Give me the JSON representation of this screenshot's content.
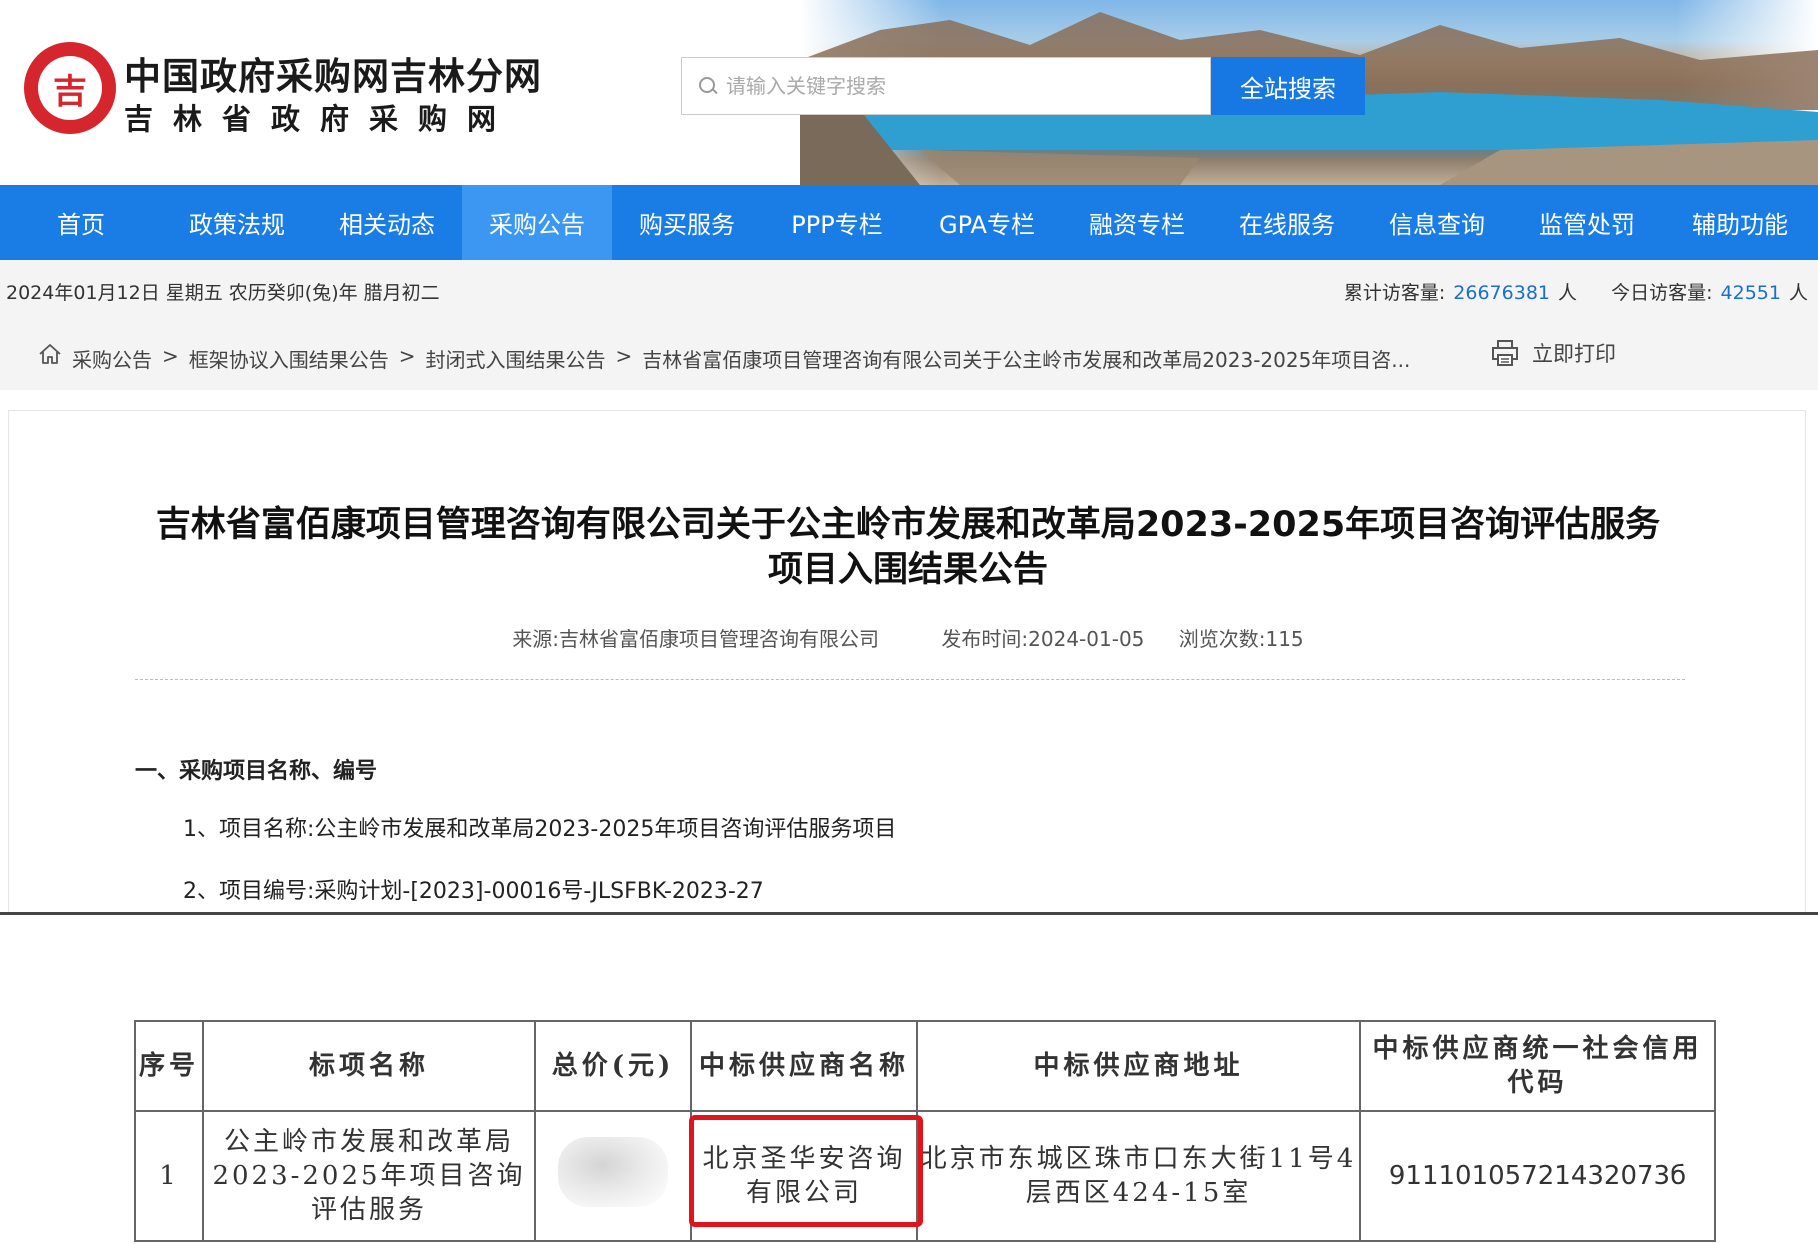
{
  "header": {
    "logo_text": "吉",
    "site_title": "中国政府采购网吉林分网",
    "site_subtitle": "吉林省政府采购网",
    "search_placeholder": "请输入关键字搜索",
    "search_button": "全站搜索"
  },
  "nav": {
    "items": [
      {
        "label": "首页"
      },
      {
        "label": "政策法规"
      },
      {
        "label": "相关动态"
      },
      {
        "label": "采购公告"
      },
      {
        "label": "购买服务"
      },
      {
        "label": "PPP专栏"
      },
      {
        "label": "GPA专栏"
      },
      {
        "label": "融资专栏"
      },
      {
        "label": "在线服务"
      },
      {
        "label": "信息查询"
      },
      {
        "label": "监管处罚"
      },
      {
        "label": "辅助功能"
      }
    ],
    "active_index": 3
  },
  "infobar": {
    "date": "2024年01月12日 星期五 农历癸卯(兔)年 腊月初二",
    "total_label": "累计访客量:",
    "total_value": "26676381",
    "total_unit": "人",
    "today_label": "今日访客量:",
    "today_value": "42551",
    "today_unit": "人"
  },
  "breadcrumb": {
    "items": [
      "采购公告",
      "框架协议入围结果公告",
      "封闭式入围结果公告",
      "吉林省富佰康项目管理咨询有限公司关于公主岭市发展和改革局2023-2025年项目咨..."
    ],
    "separator": ">",
    "print_label": "立即打印"
  },
  "article": {
    "title_line1": "吉林省富佰康项目管理咨询有限公司关于公主岭市发展和改革局2023-2025年项目咨询评估服务",
    "title_line2": "项目入围结果公告",
    "source": "来源:吉林省富佰康项目管理咨询有限公司",
    "publish_time": "发布时间:2024-01-05",
    "views": "浏览次数:115",
    "section1": "一、采购项目名称、编号",
    "item1": "1、项目名称:公主岭市发展和改革局2023-2025年项目咨询评估服务项目",
    "item2": "2、项目编号:采购计划-[2023]-00016号-JLSFBK-2023-27"
  },
  "result_table": {
    "headers": [
      "序号",
      "标项名称",
      "总价(元)",
      "中标供应商名称",
      "中标供应商地址",
      "中标供应商统一社会信用代码"
    ],
    "row": {
      "index": "1",
      "item_name": "公主岭市发展和改革局2023-2025年项目咨询评估服务",
      "supplier": "北京圣华安咨询有限公司",
      "address": "北京市东城区珠市口东大街11号4层西区424-15室",
      "credit_code": "91110105721432073б"
    }
  }
}
